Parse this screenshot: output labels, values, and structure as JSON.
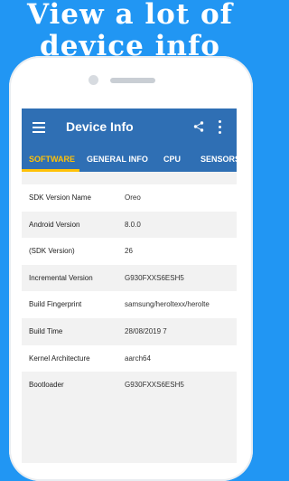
{
  "promo": {
    "line1": "View a lot of",
    "line2": "device info"
  },
  "appbar": {
    "title": "Device Info",
    "menu_icon": "hamburger-menu-icon",
    "share_icon": "share-icon",
    "more_icon": "more-vert-icon",
    "color": "#2f6fb4"
  },
  "tabs": [
    {
      "label": "SOFTWARE",
      "active": true
    },
    {
      "label": "GENERAL INFO",
      "active": false
    },
    {
      "label": "CPU",
      "active": false
    },
    {
      "label": "SENSORS",
      "active": false
    }
  ],
  "colors": {
    "background": "#2196f3",
    "tab_active": "#ffc107"
  },
  "rows": [
    {
      "key": "SDK Version Name",
      "value": "Oreo"
    },
    {
      "key": "Android Version",
      "value": "8.0.0"
    },
    {
      "key": "(SDK Version)",
      "value": "26"
    },
    {
      "key": "Incremental Version",
      "value": "G930FXXS6ESH5"
    },
    {
      "key": "Build Fingerprint",
      "value": "samsung/heroltexx/herolte"
    },
    {
      "key": "Build Time",
      "value": "28/08/2019 7"
    },
    {
      "key": "Kernel Architecture",
      "value": "aarch64"
    },
    {
      "key": "Bootloader",
      "value": "G930FXXS6ESH5"
    }
  ]
}
